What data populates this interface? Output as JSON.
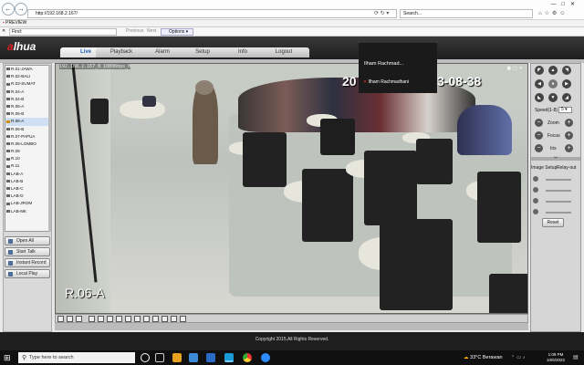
{
  "browser": {
    "address": "http://192.168.2.167/",
    "search_placeholder": "Search...",
    "tab_title": "PREVIEW",
    "find_label": "Find:",
    "find_prev": "Previous",
    "find_next": "Next",
    "find_options": "Options"
  },
  "app": {
    "logo_a": "a",
    "logo_rest": "lhua",
    "tabs": [
      "Live",
      "Playback",
      "Alarm",
      "Setup",
      "Info",
      "Logout"
    ],
    "active_tab": "Live"
  },
  "cameras": [
    "R.01-JAWA",
    "R.02-BALI",
    "R.03-SUMAT",
    "R.04-A",
    "R.04-B",
    "R.05-A",
    "R.05-B",
    "R.06-A",
    "R.06-B",
    "R.07-PAPUA",
    "R.08-LOMBO",
    "R.09",
    "R.10",
    "R.11",
    "LAB-A",
    "LAB-B",
    "LAB-C",
    "LAB-D",
    "LAB-JROM",
    "LAB-MK"
  ],
  "selected_camera": "R.06-A",
  "left_buttons": [
    "Open All",
    "Start Talk",
    "Instant Record",
    "Local Play"
  ],
  "video": {
    "osd_info": "192.168.2.167_8 1080Kbps_H",
    "camera_name": "R.06-A",
    "date_partial": "20",
    "time_partial": "3-08-38"
  },
  "popup": {
    "name_top": "Ilham Rachmad...",
    "name_bottom": "Ilham Rachmadhani"
  },
  "ptz": {
    "speed_label": "Speed(1-8)",
    "speed_value": "5",
    "zoom_label": "Zoom",
    "focus_label": "Focus",
    "iris_label": "Iris"
  },
  "image_setup": {
    "label": "Image Setup",
    "relay_label": "Relay-out",
    "reset_label": "Reset"
  },
  "footer": {
    "copyright": "Copyright 2015,All Rights Reserved."
  },
  "taskbar": {
    "search_placeholder": "Type here to search",
    "weather": "33°C  Berawan",
    "time": "1:09 PM",
    "date": "10/6/2022"
  }
}
